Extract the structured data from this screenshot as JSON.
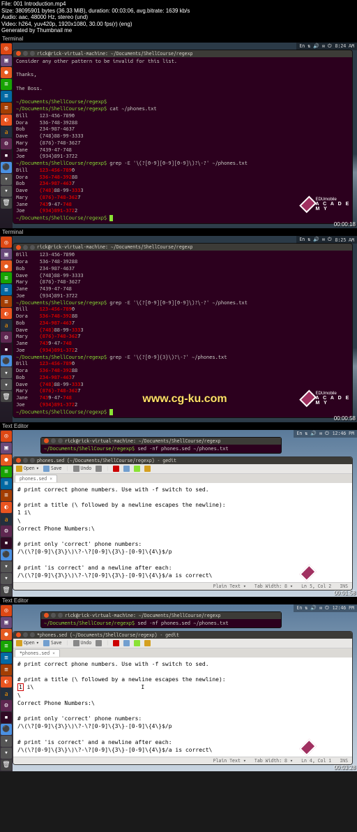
{
  "video_meta": {
    "file": "File: 001 Introduction.mp4",
    "size": "Size: 38095901 bytes (36.33 MiB), duration: 00:03:06, avg.bitrate: 1639 kb/s",
    "audio": "Audio: aac, 48000 Hz, stereo (und)",
    "video": "Video: h264, yuv420p, 1920x1080, 30.00 fps(r) (eng)",
    "gen": "Generated by Thumbnail me"
  },
  "watermark": "www.cg-ku.com",
  "academy": {
    "brand": "EDUmobile",
    "label": "A C A D E M Y"
  },
  "shot1": {
    "header_left": "Terminal",
    "topbar_time": "8:24 AM",
    "topbar_icons": "En  ⇅  🔊  ✉  ⏻",
    "title": "rick@rick-virtual-machine: ~/Documents/ShellCourse/regexp",
    "line1": "Consider any other pattern to be invalid for this list.",
    "line2": "Thanks,",
    "line3": "The Boss.",
    "p1": "~/Documents/ShellCourse/regexp$",
    "cmd1": " cat ~/phones.txt",
    "rows": [
      [
        "Bill",
        "123-456-7890"
      ],
      [
        "Dora",
        "536-748-39288"
      ],
      [
        "Bob",
        "234-987-4637"
      ],
      [
        "Dave",
        "(748)88-99-3333"
      ],
      [
        "Mary",
        "(876)-748-3627"
      ],
      [
        "Jane",
        "7439-47-748"
      ],
      [
        "Joe",
        "(934)891-3722"
      ]
    ],
    "cmd2": " grep -E '\\(?[0-9][0-9][0-9]\\)?\\-?' ~/phones.txt",
    "hl_rows": [
      {
        "name": "Bill",
        "pre": "",
        "mid": "123-456-789",
        "post": "0"
      },
      {
        "name": "Dora",
        "pre": "",
        "mid": "536-748-392",
        "post": "88"
      },
      {
        "name": "Bob",
        "pre": "",
        "mid": "234-987-463",
        "post": "7"
      },
      {
        "name": "Dave",
        "pre": "",
        "mid": "(748)",
        "post": "88-99-",
        "mid2": "333",
        "post2": "3"
      },
      {
        "name": "Mary",
        "pre": "",
        "mid": "(876)-748-362",
        "post": "7"
      },
      {
        "name": "Jane",
        "pre": "",
        "mid": "743",
        "post": "9-47-",
        "mid2": "748",
        "post2": ""
      },
      {
        "name": "Joe",
        "pre": "",
        "mid": "(934)891-372",
        "post": "2"
      }
    ],
    "p_end": "~/Documents/ShellCourse/regexp$ ",
    "ts": "00:00:18"
  },
  "shot2": {
    "header_left": "Terminal",
    "topbar_time": "8:25 AM",
    "title": "rick@rick-virtual-machine: ~/Documents/ShellCourse/regexp",
    "rows": [
      [
        "Bill",
        "123-456-7890"
      ],
      [
        "Dora",
        "536-748-39288"
      ],
      [
        "Bob",
        "234-987-4637"
      ],
      [
        "Dave",
        "(748)88-99-3333"
      ],
      [
        "Mary",
        "(876)-748-3627"
      ],
      [
        "Jane",
        "7439-47-748"
      ],
      [
        "Joe",
        "(934)891-3722"
      ]
    ],
    "p1": "~/Documents/ShellCourse/regexp$",
    "cmd1": " grep -E '\\(?[0-9][0-9][0-9]\\)?\\-?' ~/phones.txt",
    "hl_rows": [
      {
        "name": "Bill",
        "mid": "123-456-789",
        "post": "0"
      },
      {
        "name": "Dora",
        "mid": "536-748-392",
        "post": "88"
      },
      {
        "name": "Bob",
        "mid": "234-987-463",
        "post": "7"
      },
      {
        "name": "Dave",
        "mid": "(748)",
        "post": "88-99-",
        "mid2": "333",
        "post2": "3"
      },
      {
        "name": "Mary",
        "mid": "(876)-748-362",
        "post": "7"
      },
      {
        "name": "Jane",
        "mid": "743",
        "post": "9-47-",
        "mid2": "748",
        "post2": ""
      },
      {
        "name": "Joe",
        "mid": "(934)891-372",
        "post": "2"
      }
    ],
    "cmd2": " grep -E '\\(?[0-9]{3}\\)?\\-?' ~/phones.txt",
    "hl_rows2": [
      {
        "name": "Bill",
        "mid": "123-456-789",
        "post": "0"
      },
      {
        "name": "Dora",
        "mid": "536-748-392",
        "post": "88"
      },
      {
        "name": "Bob",
        "mid": "234-987-463",
        "post": "7"
      },
      {
        "name": "Dave",
        "mid": "(748)",
        "post": "88-99-",
        "mid2": "333",
        "post2": "3"
      },
      {
        "name": "Mary",
        "mid": "(876)-748-362",
        "post": "7"
      },
      {
        "name": "Jane",
        "mid": "743",
        "post": "9-47-",
        "mid2": "748",
        "post2": ""
      },
      {
        "name": "Joe",
        "mid": "(934)891-372",
        "post": "2"
      }
    ],
    "p_end": "~/Documents/ShellCourse/regexp$ ",
    "ts": "00:00:58"
  },
  "shot3": {
    "header_left": "Text Editor",
    "topbar_time": "12:46 PM",
    "strip_title": "rick@rick-virtual-machine: ~/Documents/ShellCourse/regexp",
    "strip_prompt": "~/Documents/ShellCourse/regexp$",
    "strip_cmd": " sed -nf phones.sed ~/phones.txt",
    "gedit_title": "phones.sed (~/Documents/ShellCourse/regexp) - gedit",
    "tb": {
      "open": "Open",
      "save": "Save",
      "undo": "Undo"
    },
    "tab": "phones.sed",
    "body": "# print correct phone numbers. Use with -f switch to sed.\n\n# print a title (\\ followed by a newline escapes the newline):\n1 i\\\n\\\nCorrect Phone Numbers:\\\n\n# print only 'correct' phone numbers:\n/\\(\\?[0-9]\\{3\\}\\)\\?-\\?[0-9]\\{3\\}-[0-9]\\{4\\}$/p\n\n# print 'is correct' and a newline after each:\n/\\(\\?[0-9]\\{3\\}\\)\\?-\\?[0-9]\\{3\\}-[0-9]\\{4\\}$/a is correct\\",
    "status": {
      "mode": "Plain Text ▾",
      "tab": "Tab Width: 8 ▾",
      "pos": "Ln 5, Col 2",
      "ins": "INS"
    },
    "ts": "00:01:58"
  },
  "shot4": {
    "header_left": "Text Editor",
    "topbar_time": "12:46 PM",
    "strip_title": "rick@rick-virtual-machine: ~/Documents/ShellCourse/regexp",
    "strip_prompt": "~/Documents/ShellCourse/regexp$",
    "strip_cmd": " sed -nf phones.sed ~/phones.txt",
    "gedit_title": "*phones.sed (~/Documents/ShellCourse/regexp) - gedit",
    "tb": {
      "open": "Open",
      "save": "Save",
      "undo": "Undo"
    },
    "tab": "*phones.sed",
    "body_pre": "# print correct phone numbers. Use with -f switch to sed.\n\n# print a title (\\ followed by a newline escapes the newline):\n",
    "body_err": "1",
    "body_mid": " i\\                                I\n\\\nCorrect Phone Numbers:\\\n\n# print only 'correct' phone numbers:\n/\\(\\?[0-9]\\{3\\}\\)\\?-\\?[0-9]\\{3\\}-[0-9]\\{4\\}$/p\n\n# print 'is correct' and a newline after each:\n/\\(\\?[0-9]\\{3\\}\\)\\?-\\?[0-9]\\{3\\}-[0-9]\\{4\\}$/a is correct\\",
    "status": {
      "mode": "Plain Text ▾",
      "tab": "Tab Width: 8 ▾",
      "pos": "Ln 4, Col 1",
      "ins": "INS"
    },
    "ts": "00:03:28"
  },
  "launcher_labels": [
    "◎",
    "📁",
    "🦊",
    "≡",
    "≡",
    "≡",
    "◐",
    "a",
    "⚙",
    "▪",
    "⚫",
    "▾",
    "▾",
    "🗑"
  ]
}
